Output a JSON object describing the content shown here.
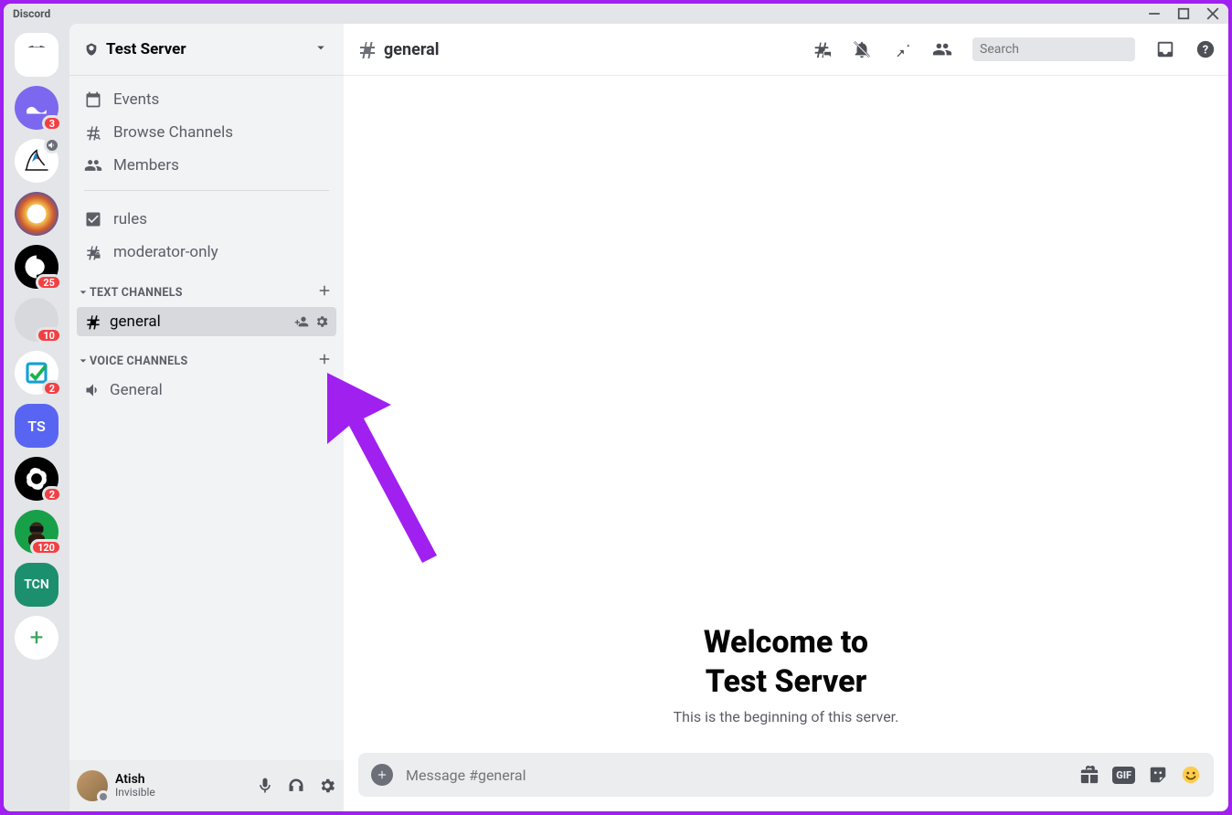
{
  "titlebar": {
    "app": "Discord"
  },
  "guild_rail": {
    "badges": {
      "s1": "3",
      "s3": "25",
      "s4": "10",
      "s5": "2",
      "s7": "2",
      "s8": "120"
    },
    "labels": {
      "ts": "TS",
      "tcn": "TCN"
    },
    "add_label": "+"
  },
  "server": {
    "name": "Test Server",
    "nav": {
      "events": "Events",
      "browse": "Browse Channels",
      "members": "Members",
      "rules": "rules",
      "mod": "moderator-only"
    },
    "categories": {
      "text": "TEXT CHANNELS",
      "voice": "VOICE CHANNELS"
    },
    "channels": {
      "general": "general",
      "voice_general": "General"
    }
  },
  "user_panel": {
    "name": "Atish",
    "status": "Invisible"
  },
  "chat_header": {
    "channel": "general",
    "search_placeholder": "Search"
  },
  "chat_body": {
    "welcome_line1": "Welcome to",
    "welcome_line2": "Test Server",
    "subtitle": "This is the beginning of this server."
  },
  "composer": {
    "placeholder": "Message #general"
  }
}
